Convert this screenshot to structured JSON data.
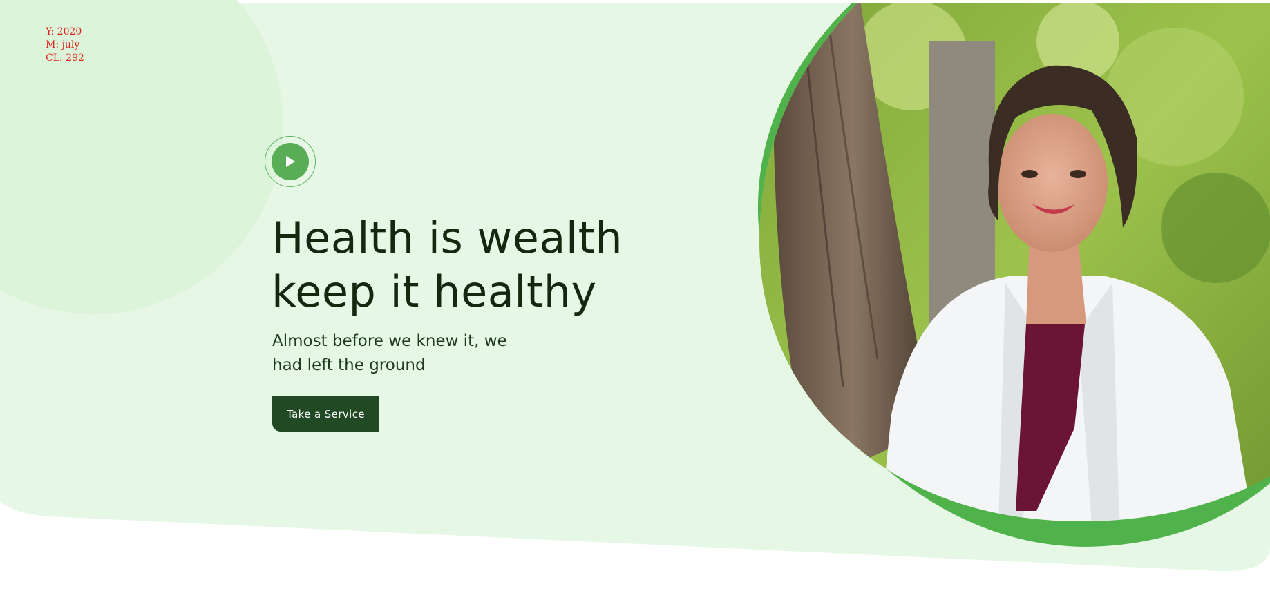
{
  "meta": {
    "year_line": "Y: 2020",
    "month_line": "M: july",
    "cl_line": "CL: 292"
  },
  "hero": {
    "headline_line1": "Health is wealth",
    "headline_line2": "keep it healthy",
    "subtext_line1": "Almost before we knew it, we",
    "subtext_line2": "had left the ground",
    "cta_label": "Take a Service",
    "play_icon": "play-icon",
    "photo_subject": "doctor-portrait"
  },
  "colors": {
    "hero_background": "#e7f7e6",
    "accent_circle": "#dcf4da",
    "ring_green": "#4fb24b",
    "button_dark_green": "#214a24",
    "play_green": "#58ad56",
    "heading_text": "#15280f",
    "meta_text_red": "#e0221b"
  }
}
